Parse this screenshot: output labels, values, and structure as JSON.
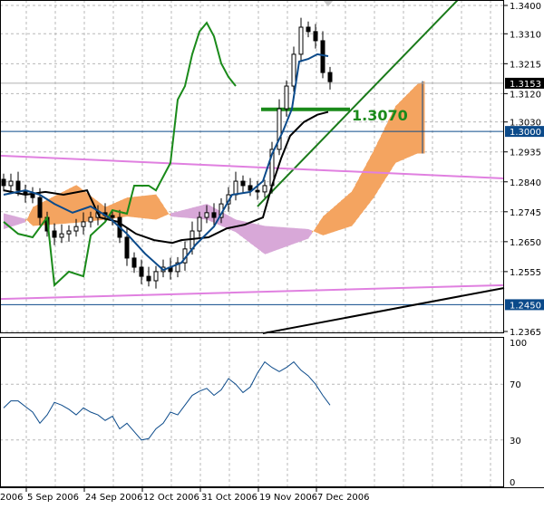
{
  "chart_data": [
    {
      "type": "candlestick",
      "title": "",
      "colors": {
        "bull": "#ffffff",
        "bear": "#000000",
        "outline": "#000000",
        "tenkan": "#0b4a8a",
        "kijun": "#000000",
        "chikou": "#1a8a1a",
        "cloud_up": "#f4a460",
        "cloud_down": "#d8a8d8",
        "cloud_edge_up": "#f4a460",
        "cloud_edge_down": "#c89ad0"
      },
      "close": [
        1.2828,
        1.2842,
        1.2813,
        1.2799,
        1.279,
        1.2727,
        1.2684,
        1.2664,
        1.2675,
        1.2684,
        1.2698,
        1.2713,
        1.2727,
        1.2742,
        1.2733,
        1.2727,
        1.2664,
        1.2598,
        1.2569,
        1.254,
        1.2526,
        1.2555,
        1.2569,
        1.2555,
        1.2583,
        1.2627,
        1.2684,
        1.2727,
        1.2742,
        1.2727,
        1.277,
        1.2799,
        1.2842,
        1.2828,
        1.2813,
        1.2808,
        1.2828,
        1.2943,
        1.3072,
        1.3144,
        1.3245,
        1.3331,
        1.3317,
        1.3288,
        1.3187,
        1.3158
      ],
      "tenkan": [
        [
          0,
          1.2799
        ],
        [
          3,
          1.2813
        ],
        [
          5,
          1.2799
        ],
        [
          7,
          1.277
        ],
        [
          9.5,
          1.2742
        ],
        [
          12,
          1.2762
        ],
        [
          14.5,
          1.2727
        ],
        [
          17,
          1.2675
        ],
        [
          19.5,
          1.2612
        ],
        [
          22,
          1.256
        ],
        [
          24.5,
          1.2583
        ],
        [
          26.5,
          1.2641
        ],
        [
          29,
          1.2698
        ],
        [
          31.5,
          1.2799
        ],
        [
          34,
          1.2808
        ],
        [
          35.75,
          1.2842
        ],
        [
          37,
          1.2928
        ],
        [
          38.5,
          1.3
        ],
        [
          39.75,
          1.3072
        ],
        [
          40.75,
          1.3222
        ],
        [
          42,
          1.323
        ],
        [
          43.25,
          1.3245
        ],
        [
          44.75,
          1.3239
        ]
      ],
      "kijun": [
        [
          0,
          1.2813
        ],
        [
          3,
          1.2799
        ],
        [
          5.75,
          1.2808
        ],
        [
          8.25,
          1.2799
        ],
        [
          11.5,
          1.2813
        ],
        [
          13.25,
          1.2727
        ],
        [
          15.75,
          1.2713
        ],
        [
          18.25,
          1.2675
        ],
        [
          20.75,
          1.2655
        ],
        [
          23.25,
          1.2646
        ],
        [
          24.5,
          1.2655
        ],
        [
          28.25,
          1.2664
        ],
        [
          30.75,
          1.2692
        ],
        [
          33.25,
          1.2704
        ],
        [
          35.75,
          1.2727
        ],
        [
          37,
          1.2828
        ],
        [
          38.25,
          1.2914
        ],
        [
          39.5,
          1.2986
        ],
        [
          41.4,
          1.303
        ],
        [
          43.25,
          1.3053
        ],
        [
          44.75,
          1.3062
        ]
      ],
      "chikou": [
        [
          0,
          1.2713
        ],
        [
          2,
          1.2675
        ],
        [
          4,
          1.2664
        ],
        [
          6,
          1.2727
        ],
        [
          7,
          1.2512
        ],
        [
          9,
          1.2555
        ],
        [
          11,
          1.254
        ],
        [
          12,
          1.267
        ],
        [
          14,
          1.2713
        ],
        [
          15,
          1.275
        ],
        [
          17,
          1.2739
        ],
        [
          18,
          1.2828
        ],
        [
          20,
          1.2828
        ],
        [
          21,
          1.2813
        ],
        [
          23,
          1.29
        ],
        [
          24,
          1.3101
        ],
        [
          25,
          1.3144
        ],
        [
          26,
          1.3245
        ],
        [
          27,
          1.3317
        ],
        [
          28,
          1.3345
        ],
        [
          29,
          1.3302
        ],
        [
          30,
          1.3216
        ],
        [
          31,
          1.3173
        ],
        [
          32,
          1.3144
        ]
      ],
      "span_a": [
        [
          0,
          1.269
        ],
        [
          3,
          1.2712
        ],
        [
          4,
          1.276
        ],
        [
          10,
          1.283
        ],
        [
          14,
          1.276
        ],
        [
          17,
          1.279
        ],
        [
          21,
          1.28
        ],
        [
          23,
          1.273
        ],
        [
          28,
          1.272
        ],
        [
          32,
          1.268
        ],
        [
          36,
          1.261
        ],
        [
          42,
          1.266
        ],
        [
          44,
          1.273
        ],
        [
          48,
          1.281
        ],
        [
          51,
          1.294
        ],
        [
          54,
          1.308
        ],
        [
          57,
          1.315
        ],
        [
          58,
          1.316
        ]
      ],
      "span_b": [
        [
          0,
          1.274
        ],
        [
          3,
          1.2722
        ],
        [
          4,
          1.27
        ],
        [
          10,
          1.271
        ],
        [
          14,
          1.272
        ],
        [
          17,
          1.273
        ],
        [
          21,
          1.272
        ],
        [
          23,
          1.274
        ],
        [
          28,
          1.277
        ],
        [
          32,
          1.272
        ],
        [
          36,
          1.27
        ],
        [
          42,
          1.269
        ],
        [
          44,
          1.267
        ],
        [
          48,
          1.27
        ],
        [
          51,
          1.279
        ],
        [
          54,
          1.29
        ],
        [
          57,
          1.293
        ],
        [
          58,
          1.293
        ]
      ],
      "trendlines": [
        {
          "color": "#1a7a1a",
          "from": [
            35,
            1.2762
          ],
          "to": [
            62.6,
            1.3417
          ]
        },
        {
          "color": "#e080e0",
          "from": [
            -0.5,
            1.2923
          ],
          "to": [
            69,
            1.2851
          ]
        },
        {
          "color": "#e080e0",
          "from": [
            -0.5,
            1.2468
          ],
          "to": [
            69,
            1.2512
          ]
        },
        {
          "color": "#000000",
          "from": [
            35.75,
            1.2359
          ],
          "to": [
            69,
            1.2503
          ]
        }
      ],
      "horizontal_levels": [
        {
          "price": 1.307,
          "color": "#1a8a1a",
          "label": "1.3070",
          "from": 35.5,
          "to": 47.75
        },
        {
          "price": 1.3,
          "color": "#0b4a8a"
        },
        {
          "price": 1.245,
          "color": "#0b4a8a"
        },
        {
          "price": 1.3153,
          "color": "#b0b0b0"
        }
      ],
      "ylim": [
        1.2365,
        1.34
      ],
      "y_ticks": [
        "1.3400",
        "1.3310",
        "1.3215",
        "1.3120",
        "1.3030",
        "1.2935",
        "1.2840",
        "1.2745",
        "1.2650",
        "1.2555",
        "1.2365"
      ],
      "price_badges": [
        {
          "label": "1.3153",
          "bg": "#000000"
        },
        {
          "label": "1.3000",
          "bg": "#0b4a8a"
        },
        {
          "label": "1.2450",
          "bg": "#0b4a8a"
        }
      ],
      "grid": true
    },
    {
      "type": "line",
      "title": "",
      "color": "#0b4a8a",
      "values": [
        53,
        58,
        58,
        54,
        50,
        42,
        48,
        57,
        55,
        52,
        48,
        53,
        50,
        48,
        44,
        47,
        38,
        42,
        36,
        30,
        31,
        38,
        42,
        50,
        48,
        55,
        62,
        65,
        67,
        62,
        66,
        74,
        70,
        64,
        68,
        78,
        86,
        82,
        79,
        82,
        86,
        80,
        76,
        70,
        62,
        55
      ],
      "ylim": [
        0,
        100
      ],
      "y_ticks": [
        "100",
        "70",
        "30",
        "0"
      ],
      "grid": true
    }
  ],
  "x_axis": {
    "tick_labels": [
      "2006",
      "5 Sep 2006",
      "24 Sep 2006",
      "12 Oct 2006",
      "31 Oct 2006",
      "19 Nov 2006",
      "7 Dec 2006"
    ]
  },
  "icons": {
    "shift_marker": "triangle-down-icon"
  }
}
